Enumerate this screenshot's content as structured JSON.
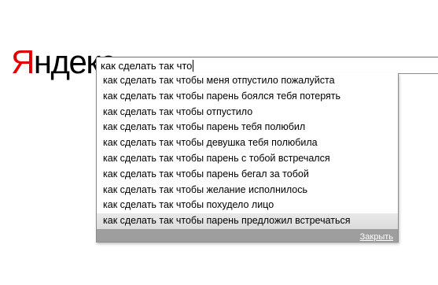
{
  "logo": {
    "first_letter": "Я",
    "rest": "ндекс",
    "accent_color": "#e30000"
  },
  "search": {
    "value": "как сделать так что"
  },
  "suggestions": [
    "как сделать так чтобы меня отпустило пожалуйста",
    "как сделать так чтобы парень боялся тебя потерять",
    "как сделать так чтобы отпустило",
    "как сделать так чтобы парень тебя полюбил",
    "как сделать так чтобы девушка тебя полюбила",
    "как сделать так чтобы парень с тобой встречался",
    "как сделать так чтобы парень бегал за тобой",
    "как сделать так чтобы желание исполнилось",
    "как сделать так чтобы похудело лицо",
    "как сделать так чтобы парень предложил встречаться"
  ],
  "footer": {
    "close_label": "Закрыть"
  }
}
